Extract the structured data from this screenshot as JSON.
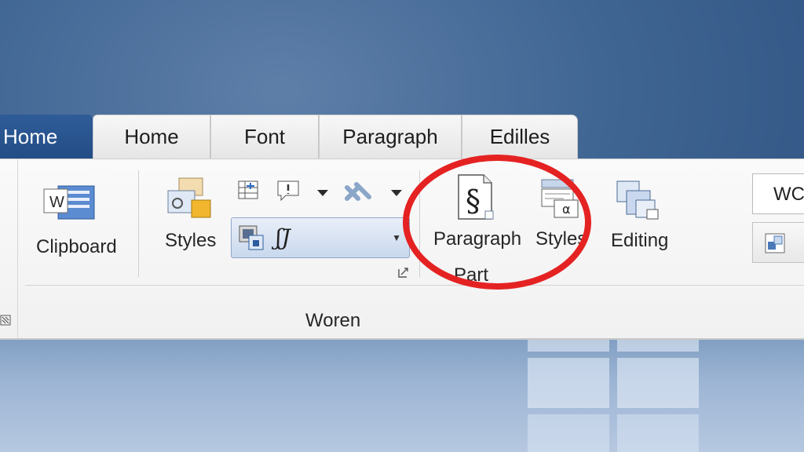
{
  "tabs": [
    {
      "label": "Home",
      "active": true
    },
    {
      "label": "Home"
    },
    {
      "label": "Font"
    },
    {
      "label": "Paragraph"
    },
    {
      "label": "Edilles"
    }
  ],
  "ribbon": {
    "clipboard_label": "Clipboard",
    "styles_label": "Styles",
    "style_sample": "ʃJ",
    "group_label": "Woren",
    "paragraph_label": "Paragraph",
    "paragraph_sub": "Part",
    "styles2_label": "Styles",
    "editing_label": "Editing",
    "right_box_text": "WC",
    "word_icon_letter": "W",
    "section_glyph": "§",
    "alpha_glyph": "α"
  },
  "colors": {
    "accent_tab": "#2a5590",
    "highlight_circle": "#e52222",
    "desktop_bg": "#3f6593"
  }
}
